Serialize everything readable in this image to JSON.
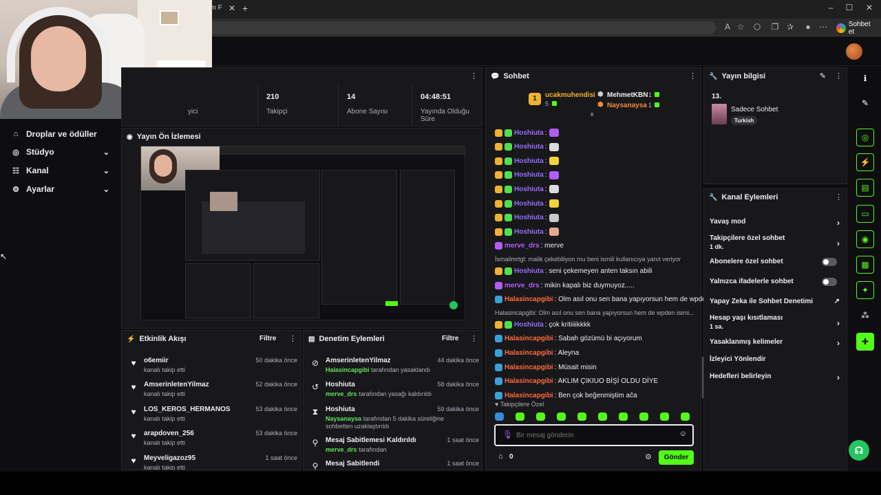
{
  "browser": {
    "tab_title": "üm F",
    "chat_button": "Sohbet et"
  },
  "sidebar": {
    "items": [
      {
        "label": "Droplar ve ödüller",
        "icon": "gift-icon"
      },
      {
        "label": "Stüdyo",
        "icon": "studio-icon"
      },
      {
        "label": "Kanal",
        "icon": "users-icon"
      },
      {
        "label": "Ayarlar",
        "icon": "gear-icon"
      }
    ]
  },
  "stats": {
    "items": [
      {
        "value": "",
        "label": "yici"
      },
      {
        "value": "210",
        "label": "Takipçi"
      },
      {
        "value": "14",
        "label": "Abone Sayısı"
      },
      {
        "value": "04:48:51",
        "label": "Yayında Olduğu Süre"
      }
    ]
  },
  "preview": {
    "title": "Yayın Ön İzlemesi"
  },
  "activity": {
    "title": "Etkinlik Akışı",
    "filter": "Filtre",
    "items": [
      {
        "name": "o6emiir",
        "sub": "kanalı takip etti",
        "time": "50 dakika önce",
        "icon": "heart-icon"
      },
      {
        "name": "AmserinletenYilmaz",
        "sub": "kanalı takip etti",
        "time": "52 dakika önce",
        "icon": "heart-icon"
      },
      {
        "name": "LOS_KEROS_HERMANOS",
        "sub": "kanalı takip etti",
        "time": "53 dakika önce",
        "icon": "heart-icon"
      },
      {
        "name": "arapdoven_256",
        "sub": "kanalı takip etti",
        "time": "53 dakika önce",
        "icon": "heart-icon"
      },
      {
        "name": "Meyveligazoz95",
        "sub": "kanalı takip etti",
        "time": "1 saat önce",
        "icon": "heart-icon"
      }
    ]
  },
  "moderation": {
    "title": "Denetim Eylemleri",
    "filter": "Filtre",
    "items": [
      {
        "name": "AmserinletenYilmaz",
        "actor": "Halasincapgibi",
        "sub": "tarafından yasaklandı",
        "time": "44 dakika önce",
        "icon": "ban-icon"
      },
      {
        "name": "Hoshiuta",
        "actor": "merve_drs",
        "sub": "tarafından yasağı kaldırıldı",
        "time": "58 dakika önce",
        "icon": "undo-icon"
      },
      {
        "name": "Hoshiuta",
        "actor": "Naysanaysa",
        "sub": "tarafından 5 dakika süreliğine sohbetten uzaklaştırıldı",
        "time": "59 dakika önce",
        "icon": "hourglass-icon"
      },
      {
        "name": "Mesaj Sabitlemesi Kaldırıldı",
        "actor": "merve_drs",
        "sub": "tarafından",
        "time": "1 saat önce",
        "icon": "unpin-icon"
      },
      {
        "name": "Mesaj Sabitlendi",
        "actor": "",
        "sub": "",
        "time": "1 saat önce",
        "icon": "pin-icon"
      }
    ]
  },
  "chat": {
    "title": "Sohbet",
    "top_gifters": [
      {
        "name": "ucakmuhendisi",
        "count": "5"
      },
      {
        "name": "MehmetKBN",
        "count": "1"
      },
      {
        "name": "Naysanaysa",
        "count": "1"
      }
    ],
    "rank_badge": "1",
    "messages": [
      {
        "user": "Hoshiuta",
        "text": ":",
        "color": "#9b6bff",
        "badges": [
          "#f0b232",
          "#4ee04e"
        ],
        "emote": "#b05cf5"
      },
      {
        "user": "Hoshiuta",
        "text": ":",
        "color": "#9b6bff",
        "badges": [
          "#f0b232",
          "#4ee04e"
        ],
        "emote": "#d9d9e0"
      },
      {
        "user": "Hoshiuta",
        "text": ":",
        "color": "#9b6bff",
        "badges": [
          "#f0b232",
          "#4ee04e"
        ],
        "emote": "#f2d23a"
      },
      {
        "user": "Hoshiuta",
        "text": ":",
        "color": "#9b6bff",
        "badges": [
          "#f0b232",
          "#4ee04e"
        ],
        "emote": "#b05cf5"
      },
      {
        "user": "Hoshiuta",
        "text": ":",
        "color": "#9b6bff",
        "badges": [
          "#f0b232",
          "#4ee04e"
        ],
        "emote": "#d9d9e0"
      },
      {
        "user": "Hoshiuta",
        "text": ":",
        "color": "#9b6bff",
        "badges": [
          "#f0b232",
          "#4ee04e"
        ],
        "emote": "#f2d23a"
      },
      {
        "user": "Hoshiuta",
        "text": ":",
        "color": "#9b6bff",
        "badges": [
          "#f0b232",
          "#4ee04e"
        ],
        "emote": "#c8c8d0"
      },
      {
        "user": "Hoshiuta",
        "text": ":",
        "color": "#9b6bff",
        "badges": [
          "#f0b232",
          "#4ee04e"
        ],
        "emote": "#e6a88c"
      },
      {
        "user": "merve_drs",
        "text": ": merve",
        "color": "#b45cf5",
        "badges": [
          "#b45cf5"
        ],
        "emote": ""
      },
      {
        "reply": "İsmailmrtgl: malik çekebiliyon mu beni ismili kullanıcıya yanıt veriyor"
      },
      {
        "user": "Hoshiuta",
        "text": ": seni çekemeyen anten taksın abili",
        "color": "#9b6bff",
        "badges": [
          "#f0b232",
          "#4ee04e"
        ],
        "emote": ""
      },
      {
        "user": "merve_drs",
        "text": ": mikin kapalı biz duymuyoz.....",
        "color": "#b45cf5",
        "badges": [
          "#b45cf5"
        ],
        "emote": ""
      },
      {
        "user": "Halasincapgibi",
        "text": ": Olm asıl onu sen bana yapıyorsun hem de wpden",
        "color": "#ff6a3d",
        "badges": [
          "#3aa0d8"
        ],
        "emote": ""
      },
      {
        "reply": "Halasincapgibi: Olm asıl onu sen bana yapıyorsun hem de wpden isimi..."
      },
      {
        "user": "Hoshiuta",
        "text": ": çok kritiiiikkkk",
        "color": "#9b6bff",
        "badges": [
          "#f0b232",
          "#4ee04e"
        ],
        "emote": ""
      },
      {
        "user": "Halasincapgibi",
        "text": ": Sabah gözümü bi açıyorum",
        "color": "#ff6a3d",
        "badges": [
          "#3aa0d8"
        ],
        "emote": ""
      },
      {
        "user": "Halasincapgibi",
        "text": ": Aleyna",
        "color": "#ff6a3d",
        "badges": [
          "#3aa0d8"
        ],
        "emote": ""
      },
      {
        "user": "Halasincapgibi",
        "text": ": Müsait misin",
        "color": "#ff6a3d",
        "badges": [
          "#3aa0d8"
        ],
        "emote": ""
      },
      {
        "user": "Halasincapgibi",
        "text": ": AKLIM ÇIKIUO BİŞİ OLDU DİYE",
        "color": "#ff6a3d",
        "badges": [
          "#3aa0d8"
        ],
        "emote": ""
      },
      {
        "user": "Halasincapgibi",
        "text": ": Ben çok beğenmiştim aĉa",
        "color": "#ff6a3d",
        "badges": [
          "#3aa0d8"
        ],
        "emote": ""
      }
    ],
    "followers_only": "Takipçilere Özel",
    "input_placeholder": "Bir mesaj gönderin",
    "points": "0",
    "send": "Gönder"
  },
  "stream_info": {
    "title": "Yayın bilgisi",
    "viewers": "13.",
    "category": "Sadece Sohbet",
    "tag": "Turkish"
  },
  "channel_actions": {
    "title": "Kanal Eylemleri",
    "items": [
      {
        "label": "Yavaş mod",
        "sub": "",
        "control": "chevron"
      },
      {
        "label": "Takipçilere özel sohbet",
        "sub": "1 dk.",
        "control": "chevron"
      },
      {
        "label": "Abonelere özel sohbet",
        "sub": "",
        "control": "toggle"
      },
      {
        "label": "Yalnızca ifadelerle sohbet",
        "sub": "",
        "control": "toggle"
      },
      {
        "label": "Yapay Zeka ile Sohbet Denetimi",
        "sub": "",
        "control": "external"
      },
      {
        "label": "Hesap yaşı kısıtlaması",
        "sub": "1 sa.",
        "control": "chevron"
      },
      {
        "label": "Yasaklanmış kelimeler",
        "sub": "",
        "control": "chevron"
      },
      {
        "label": "İzleyici Yönlendir",
        "sub": "",
        "control": "none"
      },
      {
        "label": "Hedefleri belirleyin",
        "sub": "",
        "control": "chevron"
      }
    ]
  },
  "colors": {
    "accent": "#53fc18",
    "bg": "#0e0e10",
    "panel": "#18181b"
  }
}
